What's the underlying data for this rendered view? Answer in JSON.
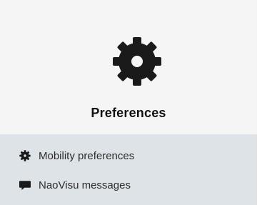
{
  "card": {
    "title": "Preferences",
    "icon": "gear-icon"
  },
  "menu": {
    "items": [
      {
        "label": "Mobility preferences",
        "icon": "gear-icon"
      },
      {
        "label": "NaoVisu messages",
        "icon": "message-icon"
      }
    ]
  },
  "colors": {
    "card_bg": "#f5f5f5",
    "menu_bg": "#dde3e7",
    "icon": "#1a1a1a",
    "text": "#2b2b2b"
  }
}
